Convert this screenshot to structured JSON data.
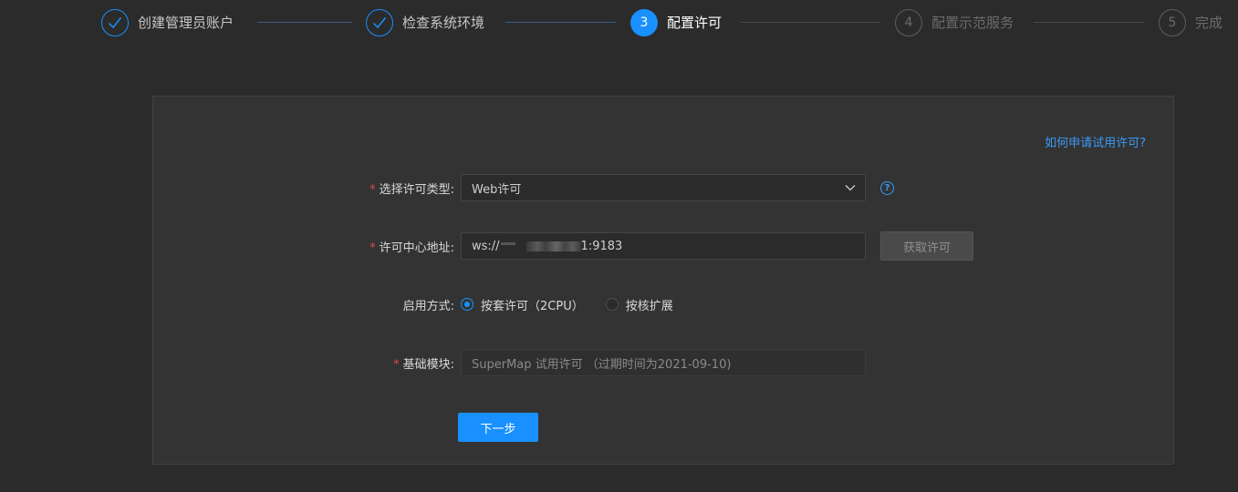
{
  "steps": [
    {
      "label": "创建管理员账户",
      "state": "done",
      "number": "1"
    },
    {
      "label": "检查系统环境",
      "state": "done",
      "number": "2"
    },
    {
      "label": "配置许可",
      "state": "active",
      "number": "3"
    },
    {
      "label": "配置示范服务",
      "state": "wait",
      "number": "4"
    },
    {
      "label": "完成",
      "state": "wait",
      "number": "5"
    }
  ],
  "help_link": "如何申请试用许可?",
  "form": {
    "license_type": {
      "label": "选择许可类型:",
      "value": "Web许可"
    },
    "license_center": {
      "label": "许可中心地址:",
      "value_prefix": "ws://",
      "value_suffix": "1:9183",
      "button": "获取许可"
    },
    "activation": {
      "label": "启用方式:",
      "options": [
        {
          "label": "按套许可（2CPU）",
          "selected": true
        },
        {
          "label": "按核扩展",
          "selected": false
        }
      ]
    },
    "base_module": {
      "label": "基础模块:",
      "value": "SuperMap 试用许可 （过期时间为2021-09-10)"
    }
  },
  "next_button": "下一步",
  "colors": {
    "accent": "#1890ff",
    "background": "#2b2b2b",
    "card": "#333333",
    "required": "#e64545"
  }
}
